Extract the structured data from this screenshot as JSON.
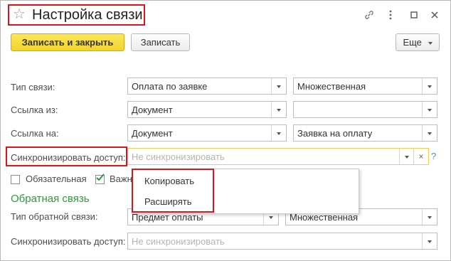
{
  "window": {
    "title": "Настройка связи"
  },
  "toolbar": {
    "save_close": "Записать и закрыть",
    "save": "Записать",
    "more": "Еще"
  },
  "form": {
    "link_type_label": "Тип связи:",
    "link_type_value": "Оплата по заявке",
    "link_multiplicity": "Множественная",
    "link_from_label": "Ссылка из:",
    "link_from_value": "Документ",
    "link_from_doc": "",
    "link_to_label": "Ссылка на:",
    "link_to_value": "Документ",
    "link_to_doc": "Заявка на оплату",
    "sync_label": "Синхронизировать доступ:",
    "sync_placeholder": "Не синхронизировать",
    "help": "?",
    "required_label": "Обязательная",
    "important_label": "Важн"
  },
  "dropdown": {
    "options": [
      "Копировать",
      "Расширять"
    ]
  },
  "reverse": {
    "section_title": "Обратная связь",
    "type_label": "Тип обратной связи:",
    "type_value": "Предмет оплаты",
    "multiplicity": "Множественная",
    "sync_label": "Синхронизировать доступ:",
    "sync_placeholder": "Не синхронизировать"
  },
  "colors": {
    "highlight": "#e0131a",
    "primary_button": "#f3d229",
    "section_title": "#2e9a3a",
    "focus_border": "#f5c85a"
  }
}
